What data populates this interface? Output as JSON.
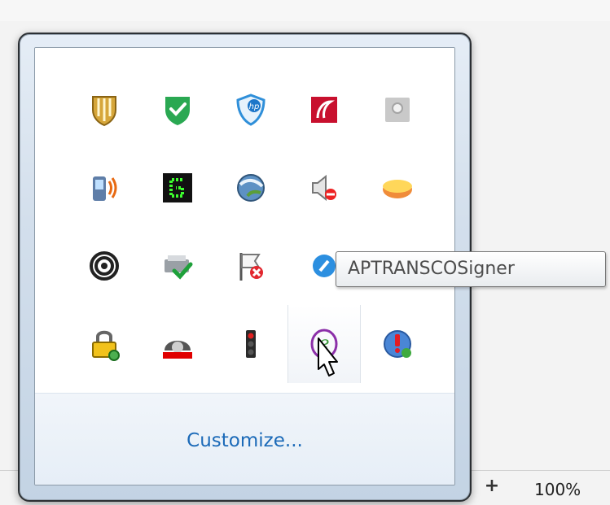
{
  "tray_popup": {
    "icons": [
      {
        "name": "shield-yellow-icon"
      },
      {
        "name": "shield-check-green-icon"
      },
      {
        "name": "hp-shield-icon"
      },
      {
        "name": "red-app-icon"
      },
      {
        "name": "gray-disc-icon"
      },
      {
        "name": "phone-signal-icon"
      },
      {
        "name": "green-terminal-icon"
      },
      {
        "name": "globe-network-icon"
      },
      {
        "name": "speaker-muted-icon"
      },
      {
        "name": "pill-icon"
      },
      {
        "name": "spiral-icon"
      },
      {
        "name": "printer-check-icon"
      },
      {
        "name": "flag-error-icon"
      },
      {
        "name": "blue-circle-icon"
      },
      {
        "name": "purple-bag-icon"
      },
      {
        "name": "padlock-icon"
      },
      {
        "name": "disk-drive-icon"
      },
      {
        "name": "traffic-light-icon"
      },
      {
        "name": "esigner-e-icon"
      },
      {
        "name": "globe-alert-icon"
      }
    ],
    "customize_label": "Customize..."
  },
  "tooltip": {
    "text": "APTRANSCOSigner"
  },
  "status_bar": {
    "zoom_label": "100%",
    "zoom_in_label": "+"
  },
  "colors": {
    "link": "#1b6ab8",
    "popup_border": "#2b2f33",
    "tooltip_border": "#767676"
  }
}
